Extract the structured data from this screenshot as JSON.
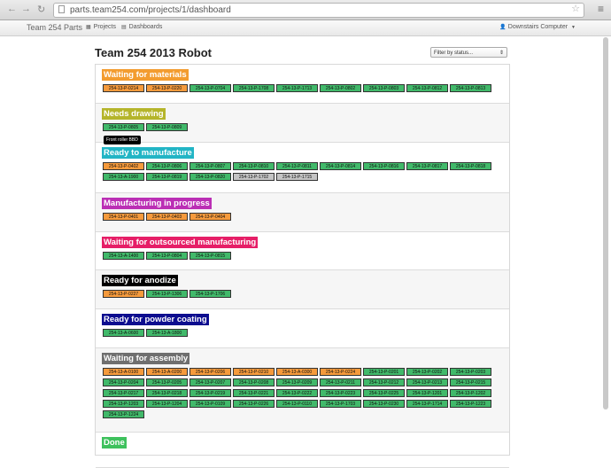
{
  "browser": {
    "url": "parts.team254.com/projects/1/dashboard",
    "back": "←",
    "forward": "→",
    "reload": "↻",
    "star": "☆",
    "menu": "≡"
  },
  "navbar": {
    "brand": "Team 254 Parts",
    "projects": "Projects",
    "dashboards": "Dashboards",
    "user": "Downstairs Computer"
  },
  "page": {
    "title": "Team 254 2013 Robot",
    "filter_placeholder": "Filter by status..."
  },
  "tooltip": "Front roller BBD",
  "sections": [
    {
      "label": "Waiting for materials",
      "color": "#f39c2f",
      "parts": [
        [
          "254-13-P-0214",
          "o"
        ],
        [
          "254-13-P-0220",
          "o"
        ],
        [
          "254-13-P-0704",
          "g"
        ],
        [
          "254-13-P-1708",
          "g"
        ],
        [
          "254-13-P-1713",
          "g"
        ],
        [
          "254-13-P-0802",
          "g"
        ],
        [
          "254-13-P-0803",
          "g"
        ],
        [
          "254-13-P-0812",
          "g"
        ],
        [
          "254-13-P-0813",
          "g"
        ]
      ]
    },
    {
      "label": "Needs drawing",
      "color": "#b5b52b",
      "parts": [
        [
          "254-13-P-0805",
          "g"
        ],
        [
          "254-13-P-0809",
          "g"
        ]
      ]
    },
    {
      "label": "Ready to manufacture",
      "color": "#22b5c5",
      "parts": [
        [
          "254-13-P-0402",
          "o"
        ],
        [
          "254-13-P-0806",
          "g"
        ],
        [
          "254-13-P-0807",
          "g"
        ],
        [
          "254-13-P-0810",
          "g"
        ],
        [
          "254-13-P-0811",
          "g"
        ],
        [
          "254-13-P-0814",
          "g"
        ],
        [
          "254-13-P-0816",
          "g"
        ],
        [
          "254-13-P-0817",
          "g"
        ],
        [
          "254-13-P-0818",
          "g"
        ],
        [
          "254-13-A-1900",
          "g"
        ],
        [
          "254-13-P-0819",
          "g"
        ],
        [
          "254-13-P-0820",
          "g"
        ],
        [
          "254-13-P-1702",
          "s"
        ],
        [
          "254-13-P-1715",
          "s"
        ]
      ]
    },
    {
      "label": "Manufacturing in progress",
      "color": "#bb2fb5",
      "parts": [
        [
          "254-13-P-0401",
          "o"
        ],
        [
          "254-13-P-0403",
          "o"
        ],
        [
          "254-13-P-0404",
          "o"
        ]
      ]
    },
    {
      "label": "Waiting for outsourced manufacturing",
      "color": "#e61e67",
      "parts": [
        [
          "254-13-A-1400",
          "g"
        ],
        [
          "254-13-P-0804",
          "g"
        ],
        [
          "254-13-P-0815",
          "g"
        ]
      ]
    },
    {
      "label": "Ready for anodize",
      "color": "#000000",
      "parts": [
        [
          "254-13-P-0227",
          "o"
        ],
        [
          "254-13-P-1306",
          "g"
        ],
        [
          "254-13-P-1706",
          "g"
        ]
      ]
    },
    {
      "label": "Ready for powder coating",
      "color": "#0d0d8f",
      "parts": [
        [
          "254-13-A-0600",
          "g"
        ],
        [
          "254-13-A-1800",
          "g"
        ]
      ]
    },
    {
      "label": "Waiting for assembly",
      "color": "#6f6f6f",
      "parts": [
        [
          "254-13-A-0100",
          "o"
        ],
        [
          "254-13-A-0200",
          "o"
        ],
        [
          "254-13-P-0206",
          "o"
        ],
        [
          "254-13-P-0210",
          "o"
        ],
        [
          "254-13-A-0300",
          "o"
        ],
        [
          "254-13-P-0224",
          "o"
        ],
        [
          "254-13-P-0201",
          "g"
        ],
        [
          "254-13-P-0202",
          "g"
        ],
        [
          "254-13-P-0203",
          "g"
        ],
        [
          "254-13-P-0204",
          "g"
        ],
        [
          "254-13-P-0205",
          "g"
        ],
        [
          "254-13-P-0207",
          "g"
        ],
        [
          "254-13-P-0208",
          "g"
        ],
        [
          "254-13-P-0209",
          "g"
        ],
        [
          "254-13-P-0211",
          "g"
        ],
        [
          "254-13-P-0212",
          "g"
        ],
        [
          "254-13-P-0213",
          "g"
        ],
        [
          "254-13-P-0215",
          "g"
        ],
        [
          "254-13-P-0217",
          "g"
        ],
        [
          "254-13-P-0218",
          "g"
        ],
        [
          "254-13-P-0219",
          "g"
        ],
        [
          "254-13-P-0221",
          "g"
        ],
        [
          "254-13-P-0222",
          "g"
        ],
        [
          "254-13-P-0223",
          "g"
        ],
        [
          "254-13-P-0225",
          "g"
        ],
        [
          "254-13-P-1201",
          "g"
        ],
        [
          "254-13-P-1202",
          "g"
        ],
        [
          "254-13-P-1203",
          "g"
        ],
        [
          "254-13-P-1204",
          "g"
        ],
        [
          "254-13-P-0109",
          "g"
        ],
        [
          "254-13-P-0226",
          "g"
        ],
        [
          "254-13-P-0110",
          "g"
        ],
        [
          "254-13-P-1703",
          "g"
        ],
        [
          "254-13-P-0230",
          "g"
        ],
        [
          "254-13-P-1714",
          "g"
        ],
        [
          "254-13-P-1223",
          "g"
        ],
        [
          "254-13-P-1224",
          "g"
        ]
      ]
    },
    {
      "label": "Done",
      "color": "#3ec15d",
      "parts": []
    }
  ]
}
